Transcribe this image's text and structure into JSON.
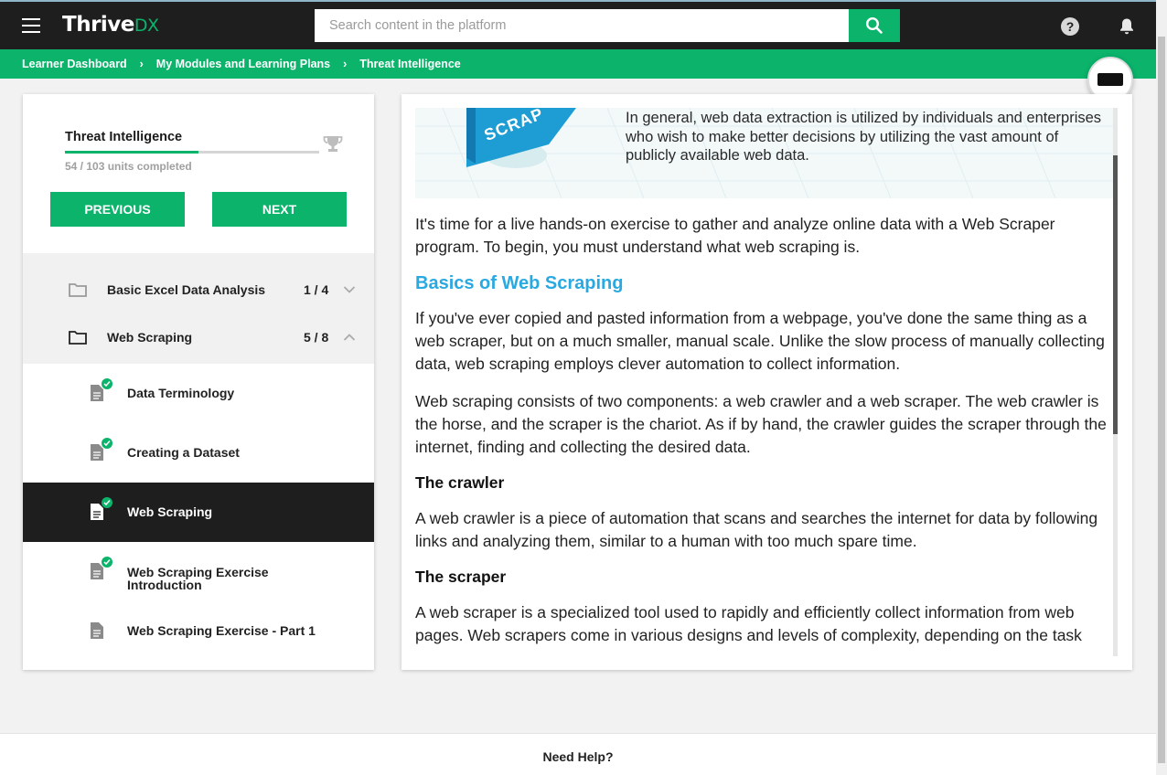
{
  "header": {
    "logo_main": "Thrive",
    "logo_suffix": "DX",
    "search_placeholder": "Search content in the platform"
  },
  "breadcrumb": [
    "Learner Dashboard",
    "My Modules and Learning Plans",
    "Threat Intelligence"
  ],
  "course": {
    "title": "Threat Intelligence",
    "progress_text": "54 / 103 units completed",
    "units_completed": 54,
    "units_total": 103,
    "previous_label": "PREVIOUS",
    "next_label": "NEXT"
  },
  "sections": [
    {
      "title": "Basic Excel Data Analysis",
      "count": "1 / 4",
      "expanded": false
    },
    {
      "title": "Web Scraping",
      "count": "5 / 8",
      "expanded": true
    }
  ],
  "units": [
    {
      "title": "Data Terminology",
      "completed": true,
      "active": false
    },
    {
      "title": "Creating a Dataset",
      "completed": true,
      "active": false
    },
    {
      "title": "Web Scraping",
      "completed": true,
      "active": true
    },
    {
      "title": "Web Scraping Exercise",
      "title_line2": "Introduction",
      "completed": true,
      "active": false
    },
    {
      "title": "Web Scraping Exercise - Part 1",
      "completed": false,
      "active": false
    }
  ],
  "banner": {
    "graphic_text": "SCRAP",
    "text": "In general, web data extraction is utilized by individuals and enterprises who wish to make better decisions by utilizing the vast amount of publicly available web data."
  },
  "article": {
    "intro": "It's time for a live hands-on exercise to gather and analyze online data with a Web Scraper program. To begin, you must understand what web scraping is.",
    "heading": "Basics of Web Scraping",
    "para1": "If you've ever copied and pasted information from a webpage, you've done the same thing as a web scraper, but on a much smaller, manual scale. Unlike the slow process of manually collecting data, web scraping employs clever automation to collect information.",
    "para2": "Web scraping consists of two components: a web crawler and a web scraper. The web crawler is the horse, and the scraper is the chariot. As if by hand, the crawler guides the scraper through the internet, finding and collecting the desired data.",
    "crawler_heading": "The crawler",
    "crawler_text": "A web crawler is a piece of automation that scans and searches the internet for data by following links and analyzing them, similar to a human with too much spare time.",
    "scraper_heading": "The scraper",
    "scraper_text": "A web scraper is a specialized tool used to rapidly and efficiently collect information from web pages. Web scrapers come in various designs and levels of complexity, depending on the task"
  },
  "footer": {
    "help_label": "Need Help?"
  },
  "colors": {
    "brand_green": "#0bb36b",
    "dark": "#1e1e1e",
    "heading_blue": "#29a9e1"
  }
}
